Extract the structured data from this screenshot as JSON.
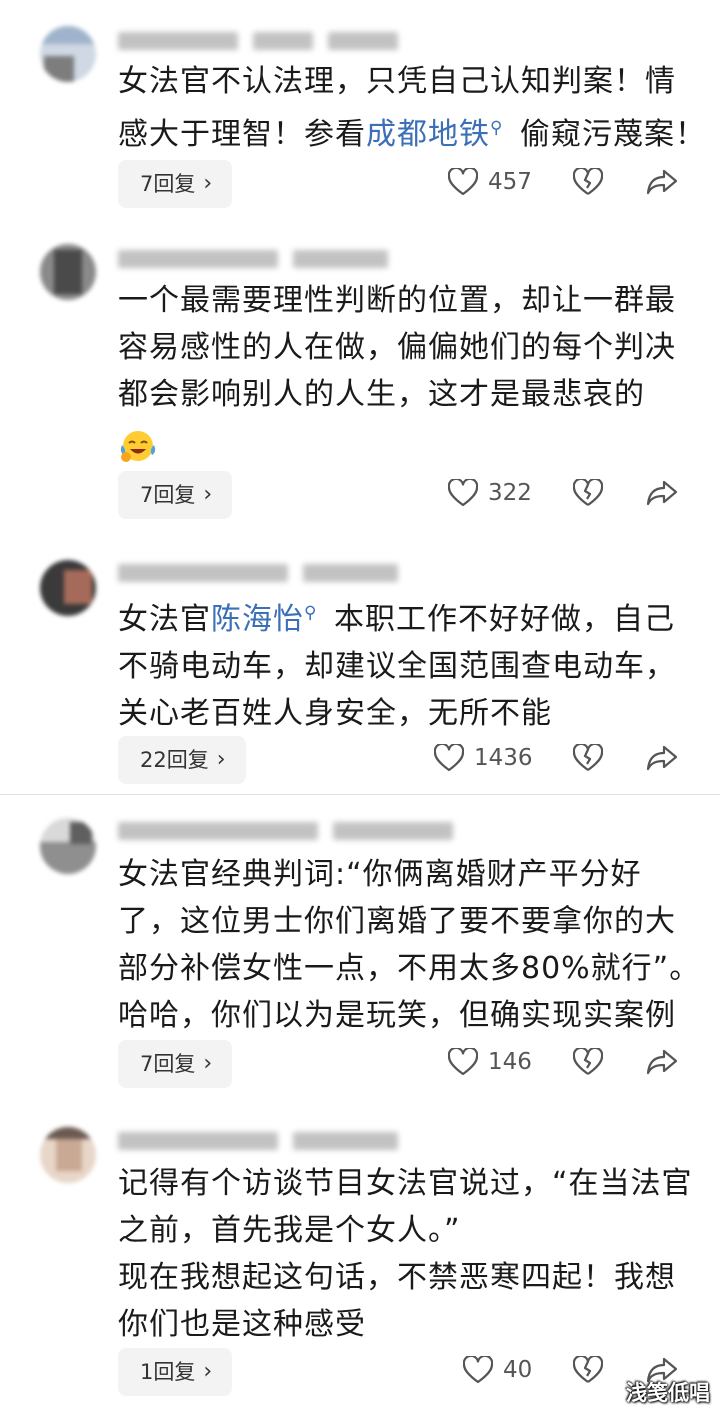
{
  "comments": [
    {
      "lines": [
        {
          "segments": [
            {
              "text": "女法官不认法理，只凭自己认知判案！情",
              "link": false
            }
          ]
        },
        {
          "segments": [
            {
              "text": "感大于理智！参看",
              "link": false
            },
            {
              "text": "成都地铁",
              "link": true
            },
            {
              "text": " 偷窥污蔑案！",
              "link": false
            }
          ]
        }
      ],
      "replies": "7回复",
      "likes": "457"
    },
    {
      "lines": [
        {
          "segments": [
            {
              "text": "一个最需要理性判断的位置，却让一群最",
              "link": false
            }
          ]
        },
        {
          "segments": [
            {
              "text": "容易感性的人在做，偏偏她们的每个判决",
              "link": false
            }
          ]
        },
        {
          "segments": [
            {
              "text": "都会影响别人的人生，这才是最悲哀的",
              "link": false
            }
          ]
        }
      ],
      "emoji": "crying-laughing-emoji",
      "replies": "7回复",
      "likes": "322"
    },
    {
      "lines": [
        {
          "segments": [
            {
              "text": "女法官",
              "link": false
            },
            {
              "text": "陈海怡",
              "link": true
            },
            {
              "text": " 本职工作不好好做，自己",
              "link": false
            }
          ]
        },
        {
          "segments": [
            {
              "text": "不骑电动车，却建议全国范围查电动车，",
              "link": false
            }
          ]
        },
        {
          "segments": [
            {
              "text": "关心老百姓人身安全，无所不能",
              "link": false
            }
          ]
        }
      ],
      "replies": "22回复",
      "likes": "1436"
    },
    {
      "lines": [
        {
          "segments": [
            {
              "text": "女法官经典判词:“你俩离婚财产平分好",
              "link": false
            }
          ]
        },
        {
          "segments": [
            {
              "text": "了，这位男士你们离婚了要不要拿你的大",
              "link": false
            }
          ]
        },
        {
          "segments": [
            {
              "text": "部分补偿女性一点，不用太多80%就行”。",
              "link": false
            }
          ]
        },
        {
          "segments": [
            {
              "text": "哈哈，你们以为是玩笑，但确实现实案例",
              "link": false
            }
          ]
        }
      ],
      "replies": "7回复",
      "likes": "146"
    },
    {
      "lines": [
        {
          "segments": [
            {
              "text": "记得有个访谈节目女法官说过，“在当法官",
              "link": false
            }
          ]
        },
        {
          "segments": [
            {
              "text": "之前，首先我是个女人。”",
              "link": false
            }
          ]
        },
        {
          "segments": [
            {
              "text": "现在我想起这句话，不禁恶寒四起！我想",
              "link": false
            }
          ]
        },
        {
          "segments": [
            {
              "text": "你们也是这种感受",
              "link": false
            }
          ]
        }
      ],
      "replies": "1回复",
      "likes": "40"
    }
  ],
  "icons": {
    "like": "heart-outline-icon",
    "dislike": "broken-heart-icon",
    "share": "share-arrow-icon",
    "chevron": "chevron-right-icon",
    "link_marker": "search-icon"
  },
  "colors": {
    "link": "#3b6fb6",
    "text": "#1a1a1a",
    "reply_bg": "#f3f3f3",
    "icon": "#555555"
  },
  "watermark": "浅笺低唱"
}
